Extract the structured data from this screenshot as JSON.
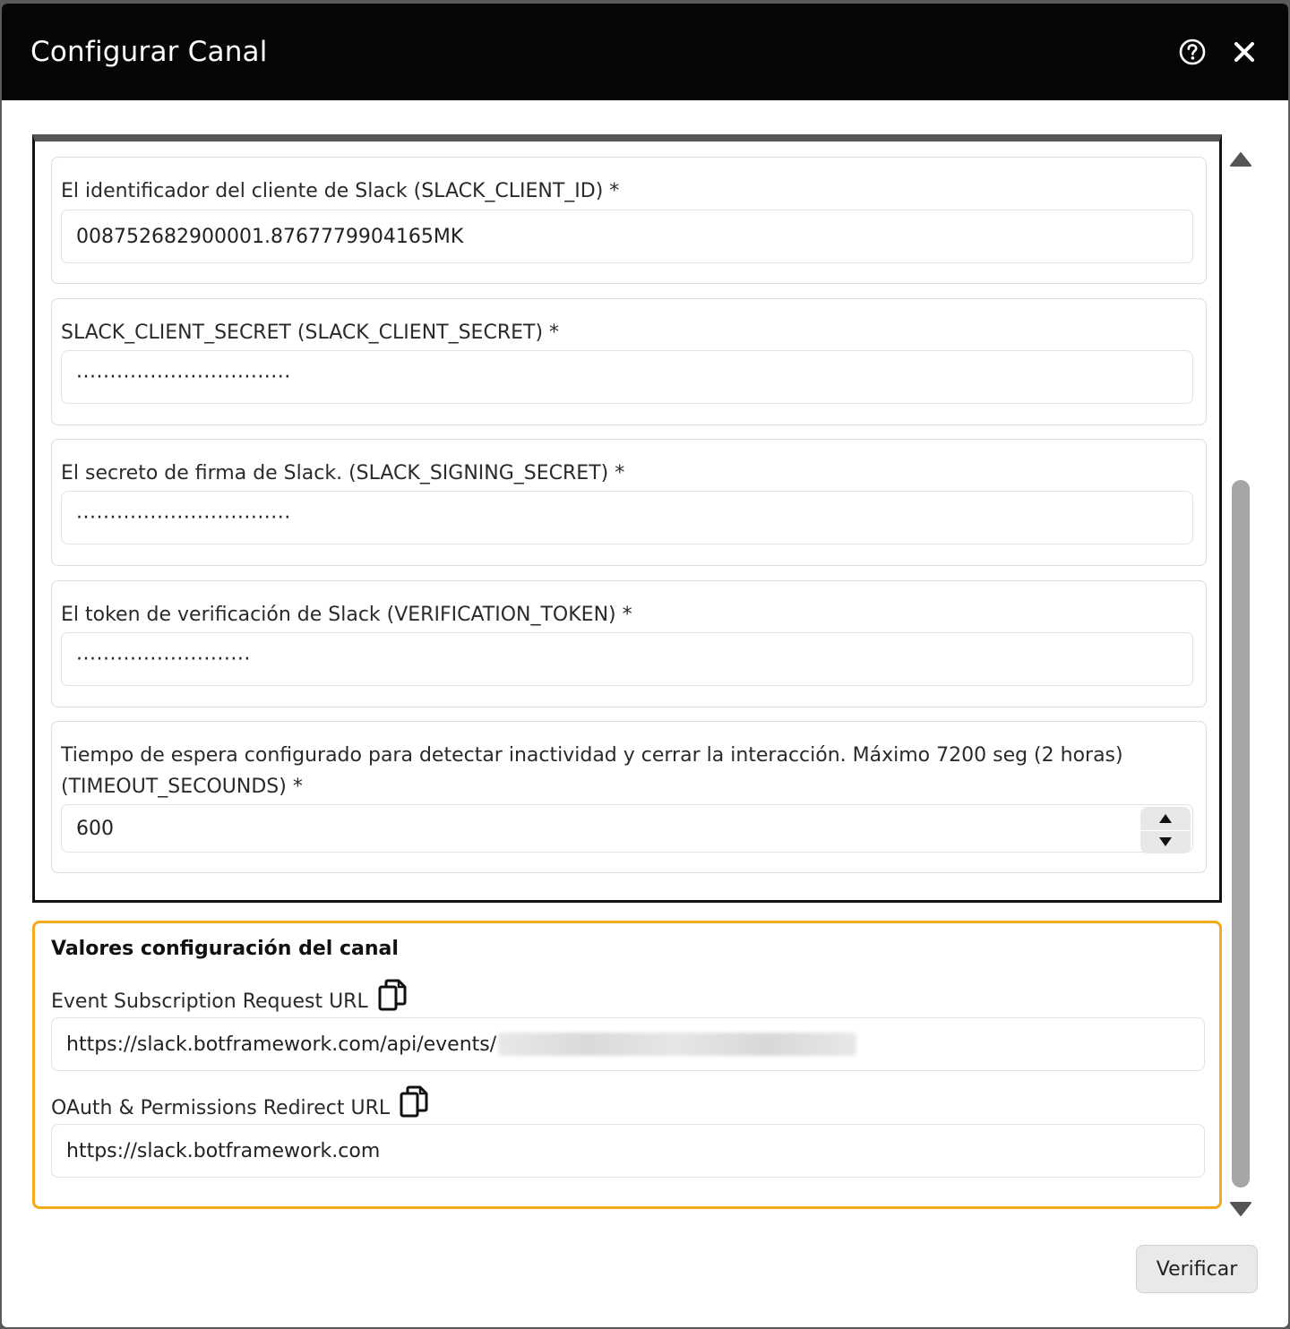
{
  "dialog": {
    "title": "Configurar Canal",
    "help_icon": "help-circle-icon",
    "close_icon": "close-icon"
  },
  "fields": [
    {
      "label": "El identificador del cliente de Slack (SLACK_CLIENT_ID) *",
      "value": "008752682900001.8767779904165MK",
      "type": "text"
    },
    {
      "label": "SLACK_CLIENT_SECRET (SLACK_CLIENT_SECRET) *",
      "value": "································",
      "type": "password"
    },
    {
      "label": "El secreto de firma de Slack. (SLACK_SIGNING_SECRET) *",
      "value": "································",
      "type": "password"
    },
    {
      "label": "El token de verificación de Slack (VERIFICATION_TOKEN) *",
      "value": "··························",
      "type": "password"
    },
    {
      "label": "Tiempo de espera configurado para detectar inactividad y cerrar la interacción. Máximo 7200 seg (2 horas) (TIMEOUT_SECOUNDS) *",
      "value": "600",
      "type": "number"
    }
  ],
  "config": {
    "title": "Valores configuración del canal",
    "event_url_label": "Event Subscription Request URL",
    "event_url_value": "https://slack.botframework.com/api/events/",
    "oauth_url_label": "OAuth & Permissions Redirect URL",
    "oauth_url_value": "https://slack.botframework.com",
    "copy_icon": "copy-icon"
  },
  "actions": {
    "verify_label": "Verificar"
  },
  "colors": {
    "titlebar": "#060606",
    "config_border": "#f5a91d",
    "scroll_thumb": "#a6a6a6"
  }
}
